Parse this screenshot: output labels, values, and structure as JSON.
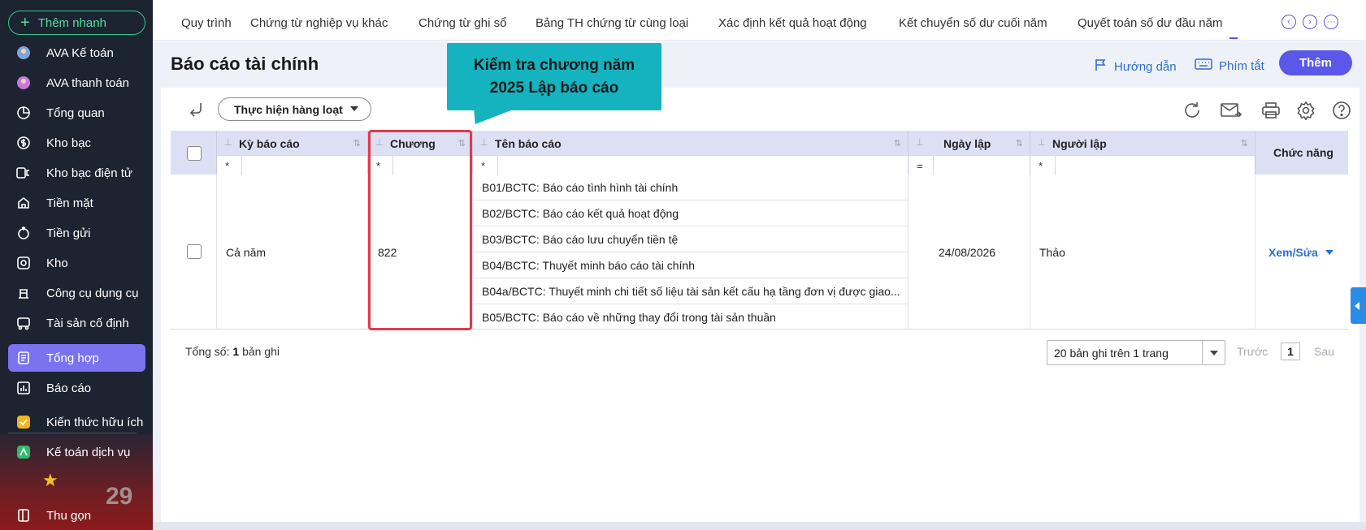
{
  "sidebar": {
    "quick_add": "Thêm nhanh",
    "items": [
      {
        "label": "AVA Kế toán",
        "icon": "ava-avatar-icon"
      },
      {
        "label": "AVA thanh toán",
        "icon": "ava-avatar-icon"
      },
      {
        "label": "Tổng quan",
        "icon": "pie-chart-icon"
      },
      {
        "label": "Kho bạc",
        "icon": "treasury-icon"
      },
      {
        "label": "Kho bạc điện tử",
        "icon": "e-treasury-icon"
      },
      {
        "label": "Tiền mặt",
        "icon": "cash-icon"
      },
      {
        "label": "Tiền gửi",
        "icon": "deposit-icon"
      },
      {
        "label": "Kho",
        "icon": "warehouse-icon"
      },
      {
        "label": "Công cụ dụng cụ",
        "icon": "tools-icon"
      },
      {
        "label": "Tài sản cố định",
        "icon": "fixed-asset-icon"
      },
      {
        "label": "Tổng hợp",
        "icon": "summary-icon"
      },
      {
        "label": "Báo cáo",
        "icon": "report-icon"
      },
      {
        "label": "Kiến thức hữu ích",
        "icon": "knowledge-icon"
      },
      {
        "label": "Kế toán dịch vụ",
        "icon": "service-icon"
      },
      {
        "label": "Thu gọn",
        "icon": "collapse-icon"
      }
    ],
    "active_index": 10,
    "decor_number": "29"
  },
  "topbar": {
    "tabs": [
      "Quy trình",
      "Chứng từ nghiệp vụ khác",
      "Chứng từ ghi sổ",
      "Bảng TH chứng từ cùng loại",
      "Xác định kết quả hoạt động",
      "Kết chuyển số dư cuối năm",
      "Quyết toán số dư đầu năm"
    ]
  },
  "header": {
    "title": "Báo cáo tài chính",
    "guide_label": "Hướng dẫn",
    "shortcut_label": "Phím tắt",
    "add_label": "Thêm"
  },
  "callout": {
    "line1": "Kiểm tra chương năm",
    "line2": "2025 Lập báo cáo"
  },
  "toolbar": {
    "bulk_label": "Thực hiện hàng loạt"
  },
  "table": {
    "columns": {
      "period": "Kỳ báo cáo",
      "chapter": "Chương",
      "name": "Tên báo cáo",
      "date": "Ngày lập",
      "creator": "Người lập",
      "action": "Chức năng"
    },
    "filters": {
      "period": "*",
      "chapter": "*",
      "name": "*",
      "date": "=",
      "creator": "*"
    },
    "row": {
      "period": "Cả năm",
      "chapter": "822",
      "reports": [
        "B01/BCTC: Báo cáo tình hình tài chính",
        "B02/BCTC: Báo cáo kết quả hoạt động",
        "B03/BCTC: Báo cáo lưu chuyển tiền tệ",
        "B04/BCTC: Thuyết minh báo cáo tài chính",
        "B04a/BCTC: Thuyết minh chi tiết số liệu tài sản kết cấu hạ tầng đơn vị được giao...",
        "B05/BCTC: Báo cáo về những thay đổi trong tài sản thuần"
      ],
      "date": "24/08/2026",
      "creator": "Thảo",
      "action": "Xem/Sửa"
    }
  },
  "footer": {
    "total_prefix": "Tổng số:",
    "total_count": "1",
    "total_suffix": "bản ghi",
    "page_size": "20 bản ghi trên 1 trang",
    "prev": "Trước",
    "page": "1",
    "next": "Sau"
  }
}
